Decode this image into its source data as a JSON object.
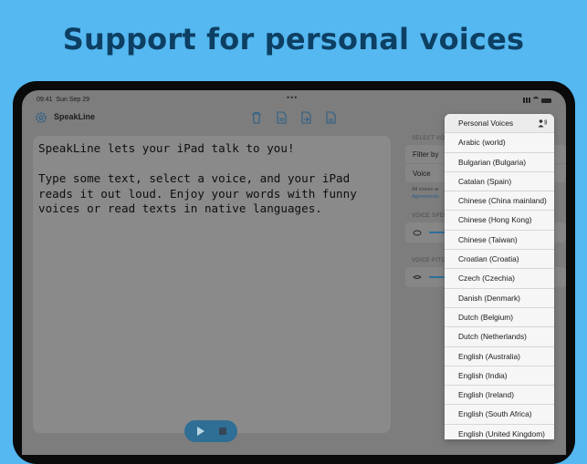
{
  "headline": "Support for personal voices",
  "status_bar": {
    "time": "09:41",
    "date": "Sun Sep 29",
    "dots": "•••"
  },
  "app": {
    "title": "SpeakLine"
  },
  "toolbar_icons": [
    "trash-icon",
    "document-icon",
    "document-import-icon",
    "document-export-icon"
  ],
  "editor": {
    "text": "SpeakLine lets your iPad talk to you!\n\nType some text, select a voice, and your iPad reads it out loud. Enjoy your words with funny voices or read texts in native languages."
  },
  "sidebar": {
    "select_voice_header": "SELECT VOI",
    "filter_label": "Filter by",
    "voice_label": "Voice",
    "note_line1": "All voices ar",
    "note_link": "Agreements",
    "voice_speed_header": "VOICE SPEE",
    "voice_pitch_header": "VOICE PITC"
  },
  "dropdown": {
    "items": [
      "Personal Voices",
      "Arabic (world)",
      "Bulgarian (Bulgaria)",
      "Catalan (Spain)",
      "Chinese (China mainland)",
      "Chinese (Hong Kong)",
      "Chinese (Taiwan)",
      "Croatian (Croatia)",
      "Czech (Czechia)",
      "Danish (Denmark)",
      "Dutch (Belgium)",
      "Dutch (Netherlands)",
      "English (Australia)",
      "English (India)",
      "English (Ireland)",
      "English (South Africa)",
      "English (United Kingdom)"
    ]
  },
  "colors": {
    "background": "#55b8f0",
    "headline": "#0d3f63",
    "accent": "#2d6f9b"
  }
}
